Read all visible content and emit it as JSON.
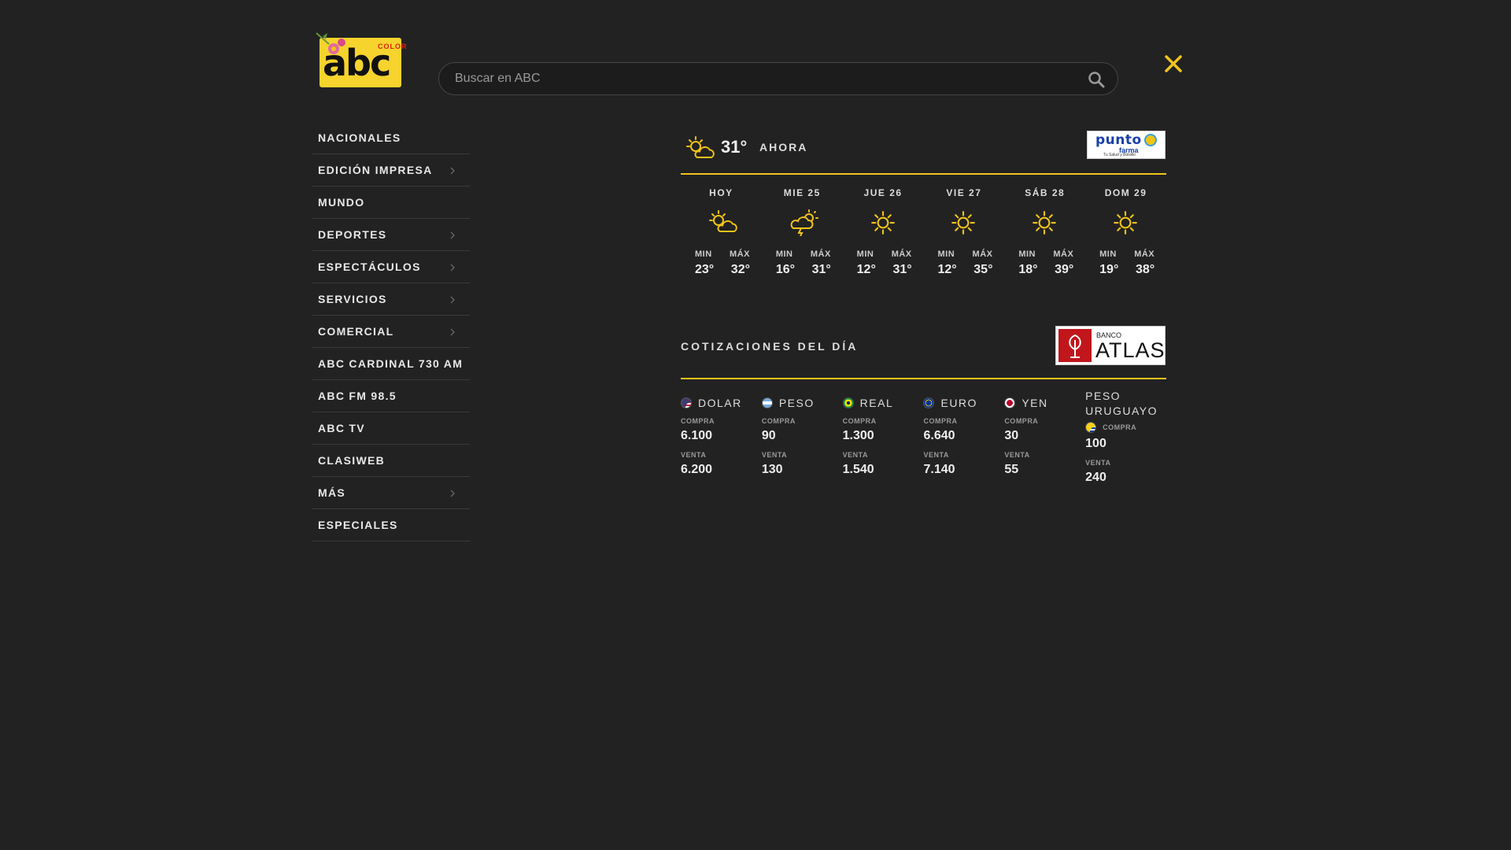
{
  "header": {
    "logo_text": "abc",
    "logo_sub": "COLOR",
    "search_placeholder": "Buscar en ABC"
  },
  "nav": [
    {
      "label": "NACIONALES",
      "submenu": false
    },
    {
      "label": "EDICIÓN IMPRESA",
      "submenu": true
    },
    {
      "label": "MUNDO",
      "submenu": false
    },
    {
      "label": "DEPORTES",
      "submenu": true
    },
    {
      "label": "ESPECTÁCULOS",
      "submenu": true
    },
    {
      "label": "SERVICIOS",
      "submenu": true
    },
    {
      "label": "COMERCIAL",
      "submenu": true
    },
    {
      "label": "ABC CARDINAL 730 AM",
      "submenu": false
    },
    {
      "label": "ABC FM 98.5",
      "submenu": false
    },
    {
      "label": "ABC TV",
      "submenu": false
    },
    {
      "label": "CLASIWEB",
      "submenu": false
    },
    {
      "label": "MÁS",
      "submenu": true
    },
    {
      "label": "ESPECIALES",
      "submenu": false
    }
  ],
  "weather": {
    "current_temp": "31°",
    "current_label": "AHORA",
    "current_icon": "partly-cloudy-icon",
    "sponsor": {
      "name": "punto",
      "name2": "farma",
      "tagline": "Tu Salud y Bolsillo"
    },
    "min_label": "MIN",
    "max_label": "MÁX",
    "days": [
      {
        "name": "HOY",
        "icon": "partly-cloudy-icon",
        "min": "23°",
        "max": "32°"
      },
      {
        "name": "MIE 25",
        "icon": "storm-icon",
        "min": "16°",
        "max": "31°"
      },
      {
        "name": "JUE 26",
        "icon": "sun-icon",
        "min": "12°",
        "max": "31°"
      },
      {
        "name": "VIE 27",
        "icon": "sun-icon",
        "min": "12°",
        "max": "35°"
      },
      {
        "name": "SÁB 28",
        "icon": "sun-icon",
        "min": "18°",
        "max": "39°"
      },
      {
        "name": "DOM 29",
        "icon": "sun-icon",
        "min": "19°",
        "max": "38°"
      }
    ]
  },
  "exchange": {
    "title": "COTIZACIONES DEL DÍA",
    "sponsor": {
      "line1": "BANCO",
      "line2": "ATLAS"
    },
    "buy_label": "COMPRA",
    "sell_label": "VENTA",
    "currencies": [
      {
        "name": "DOLAR",
        "flag": "us-flag-icon",
        "buy": "6.100",
        "sell": "6.200"
      },
      {
        "name": "PESO",
        "flag": "ar-flag-icon",
        "buy": "90",
        "sell": "130"
      },
      {
        "name": "REAL",
        "flag": "br-flag-icon",
        "buy": "1.300",
        "sell": "1.540"
      },
      {
        "name": "EURO",
        "flag": "eu-flag-icon",
        "buy": "6.640",
        "sell": "7.140"
      },
      {
        "name": "YEN",
        "flag": "jp-flag-icon",
        "buy": "30",
        "sell": "55"
      },
      {
        "name": "PESO URUGUAYO",
        "flag": "uy-flag-icon",
        "buy": "100",
        "sell": "240"
      }
    ]
  },
  "colors": {
    "background": "#222222",
    "accent": "#f0c419",
    "logo_yellow": "#f6d32d"
  }
}
